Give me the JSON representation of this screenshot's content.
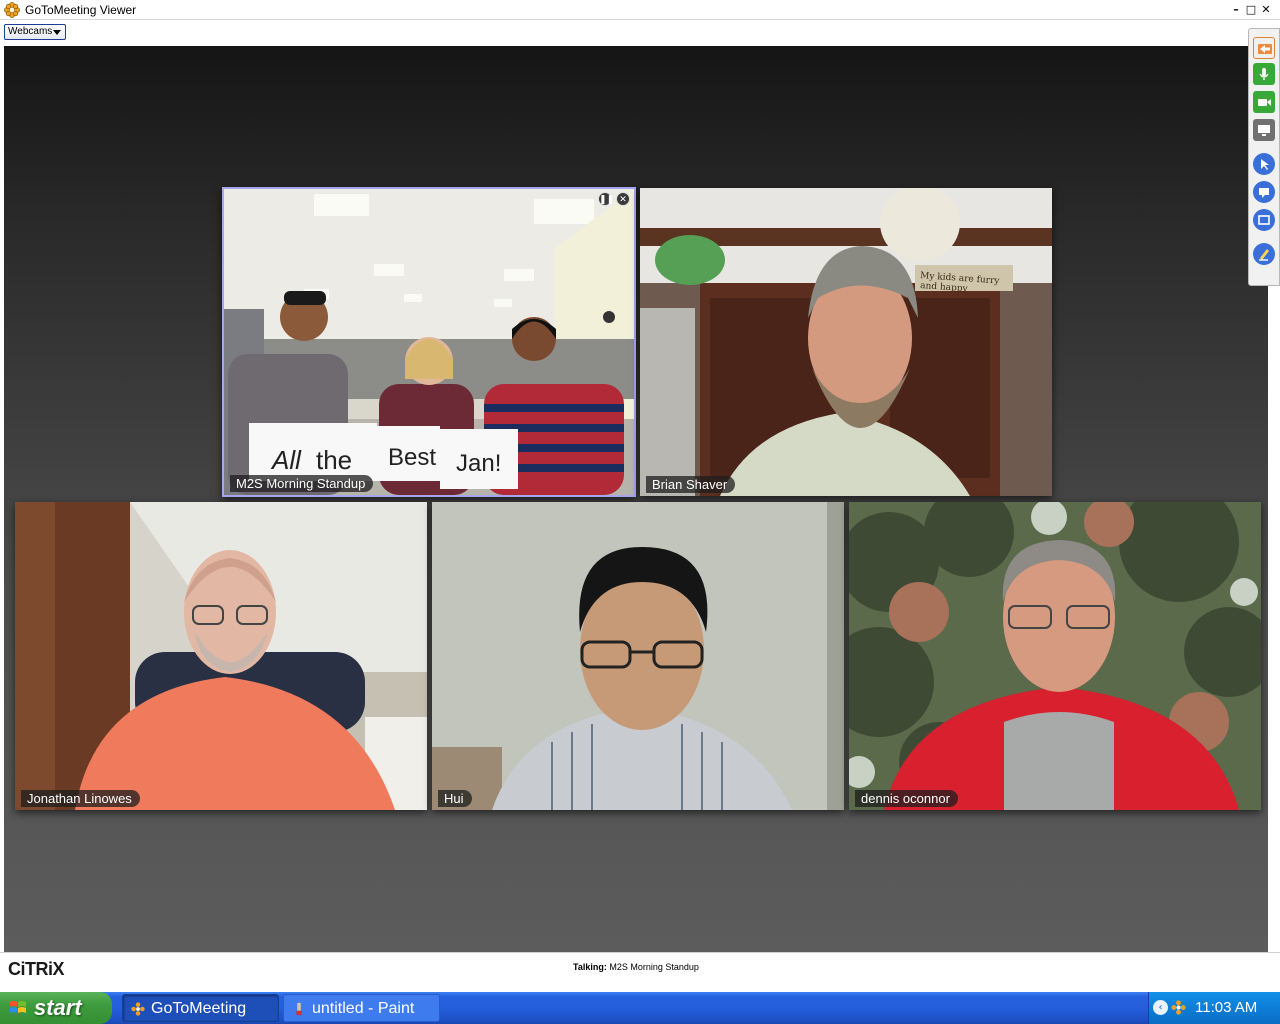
{
  "window": {
    "title": "GoToMeeting Viewer",
    "minimize_icon": "minimize-icon",
    "maximize_icon": "maximize-icon",
    "close_icon": "close-icon"
  },
  "toolbar": {
    "webcams_label": "Webcams"
  },
  "tiles": [
    {
      "name": "M2S Morning Standup",
      "selected": true,
      "sign_words": [
        "All",
        "the",
        "Best",
        "Jan!"
      ]
    },
    {
      "name": "Brian Shaver",
      "selected": false,
      "sign_text": "My kids are furry and happy"
    },
    {
      "name": "Jonathan Linowes",
      "selected": false
    },
    {
      "name": "Hui",
      "selected": false
    },
    {
      "name": "dennis oconnor",
      "selected": false
    }
  ],
  "tile_controls": {
    "pause_icon": "pause-icon",
    "close_icon": "close-circle-icon"
  },
  "control_panel": {
    "icons": [
      "exit-arrow-icon",
      "microphone-icon",
      "webcam-icon",
      "screen-share-icon",
      "pointer-icon",
      "chat-icon",
      "fullscreen-icon",
      "drawing-tool-icon"
    ]
  },
  "status": {
    "brand": "CiTRiX",
    "talking_label": "Talking:",
    "talking_value": "M2S Morning Standup"
  },
  "taskbar": {
    "start_label": "start",
    "items": [
      {
        "label": "GoToMeeting",
        "active": true
      },
      {
        "label": "untitled - Paint",
        "active": false
      }
    ],
    "clock": "11:03 AM"
  },
  "colors": {
    "selected_tile_border": "#a7a6ef",
    "taskbar_blue": "#245edb",
    "start_green": "#3d9c3d",
    "mic_green": "#38a838",
    "exit_orange": "#e8782a"
  }
}
